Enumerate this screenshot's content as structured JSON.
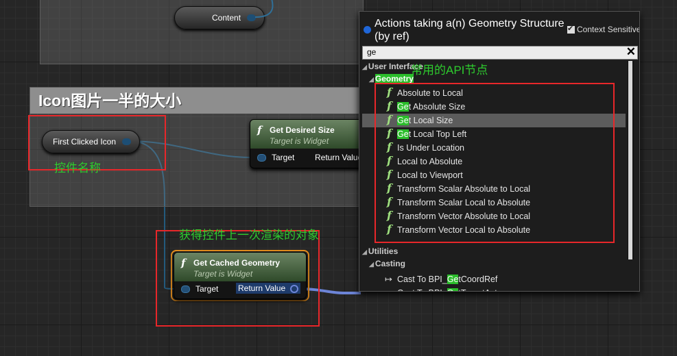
{
  "graph": {
    "content_node": {
      "label": "Content"
    },
    "comment": {
      "title": "Icon图片一半的大小"
    },
    "first_clicked_icon": {
      "label": "First Clicked Icon"
    },
    "get_desired_size": {
      "title": "Get Desired Size",
      "subtitle": "Target is Widget",
      "in_pin": "Target",
      "out_pin": "Return Value"
    },
    "get_cached_geometry": {
      "title": "Get Cached Geometry",
      "subtitle": "Target is Widget",
      "in_pin": "Target",
      "out_pin": "Return Value"
    }
  },
  "annotations": {
    "widget_name": "控件名称",
    "cached_geometry_note": "获得控件上一次渲染的对象",
    "common_api": "常用的API节点"
  },
  "popup": {
    "title": "Actions taking a(n) Geometry Structure (by ref)",
    "context_sensitive": "Context Sensitive",
    "search_value": "ge",
    "clear_icon": "✕",
    "categories": {
      "user_interface": "User Interface",
      "geometry": "Geometry",
      "utilities": "Utilities",
      "casting": "Casting"
    },
    "functions": [
      {
        "pre": "",
        "hl": "",
        "post": "Absolute to Local"
      },
      {
        "pre": "",
        "hl": "Ge",
        "post": "t Absolute Size"
      },
      {
        "pre": "",
        "hl": "Ge",
        "post": "t Local Size"
      },
      {
        "pre": "",
        "hl": "Ge",
        "post": "t Local Top Left"
      },
      {
        "pre": "",
        "hl": "",
        "post": "Is Under Location"
      },
      {
        "pre": "",
        "hl": "",
        "post": "Local to Absolute"
      },
      {
        "pre": "",
        "hl": "",
        "post": "Local to Viewport"
      },
      {
        "pre": "",
        "hl": "",
        "post": "Transform Scalar Absolute to Local"
      },
      {
        "pre": "",
        "hl": "",
        "post": "Transform Scalar Local to Absolute"
      },
      {
        "pre": "",
        "hl": "",
        "post": "Transform Vector Absolute to Local"
      },
      {
        "pre": "",
        "hl": "",
        "post": "Transform Vector Local to Absolute"
      }
    ],
    "casts": [
      {
        "pre": "Cast To BPI_",
        "hl": "Ge",
        "post": "tCoordRef"
      },
      {
        "pre": "Cast To BPI_",
        "hl": "Ge",
        "post": "tTargetActors"
      }
    ],
    "selected_index": 2,
    "colors": {
      "function_icon": "#9fe07f",
      "highlight": "#2bbd2b",
      "accent_dot": "#1f66d8"
    }
  },
  "colors": {
    "red_box": "#e8272a",
    "green_note": "#2ecc2e",
    "orange_selection": "#e8901e"
  }
}
